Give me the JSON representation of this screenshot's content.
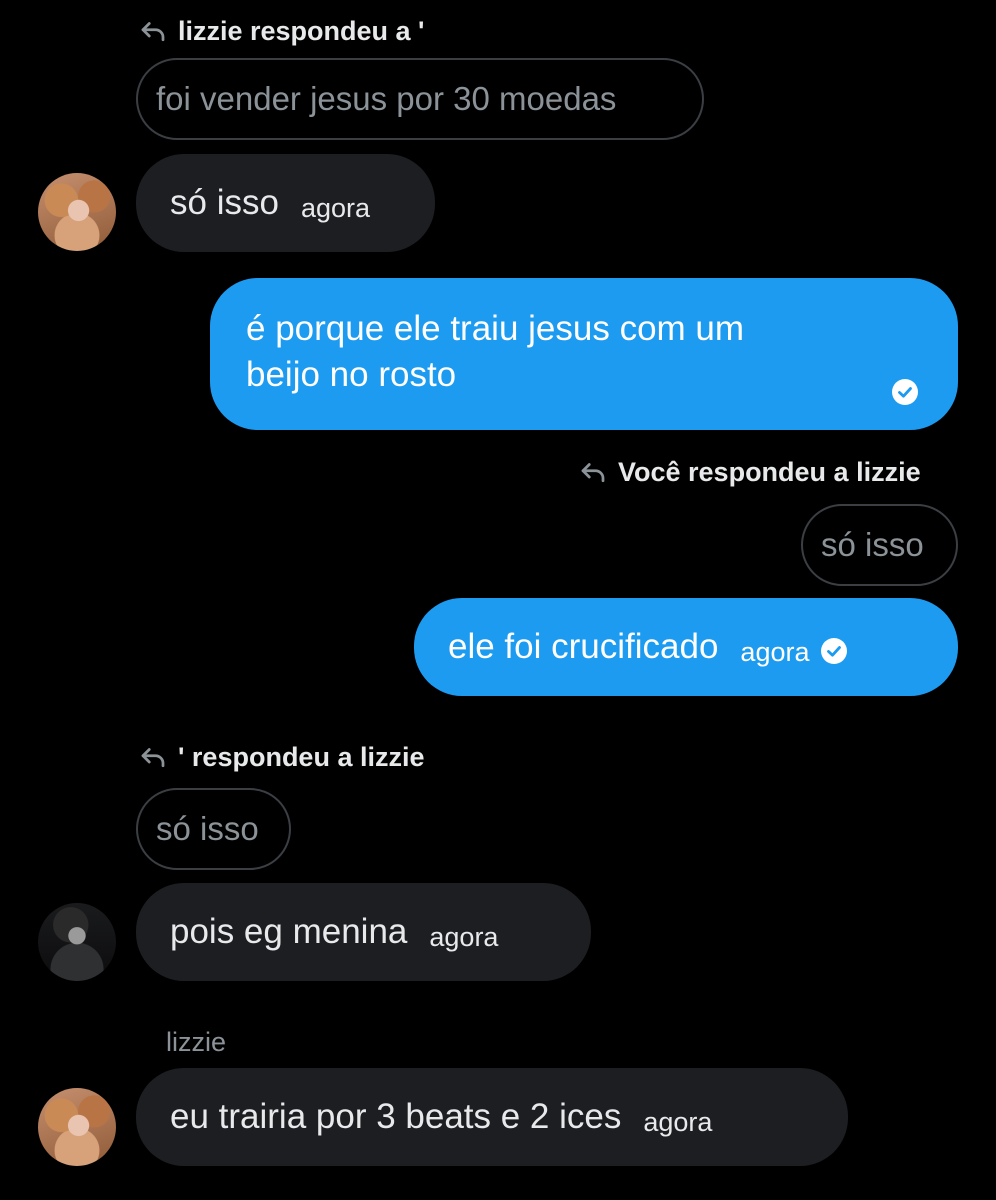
{
  "colors": {
    "background": "#000000",
    "sent_bubble": "#1d9bf0",
    "received_bubble": "#1c1e21",
    "muted_text": "#8b9298"
  },
  "icons": {
    "reply": "reply-arrow-icon",
    "seen": "check-circle-icon"
  },
  "messages": {
    "m1": {
      "reply_header": "lizzie respondeu a '",
      "quoted": "foi vender jesus por 30 moedas",
      "text": "só isso",
      "time": "agora"
    },
    "m2": {
      "text_line1": "é porque ele traiu jesus com um",
      "text_line2": "beijo no rosto"
    },
    "m3": {
      "reply_header": "Você respondeu a lizzie",
      "quoted": "só isso",
      "text": "ele foi crucificado",
      "time": "agora"
    },
    "m4": {
      "reply_header": "' respondeu a lizzie",
      "quoted": "só isso",
      "text": "pois eg menina",
      "time": "agora"
    },
    "m5": {
      "sender": "lizzie",
      "text": "eu trairia por 3 beats e 2 ices",
      "time": "agora"
    }
  }
}
